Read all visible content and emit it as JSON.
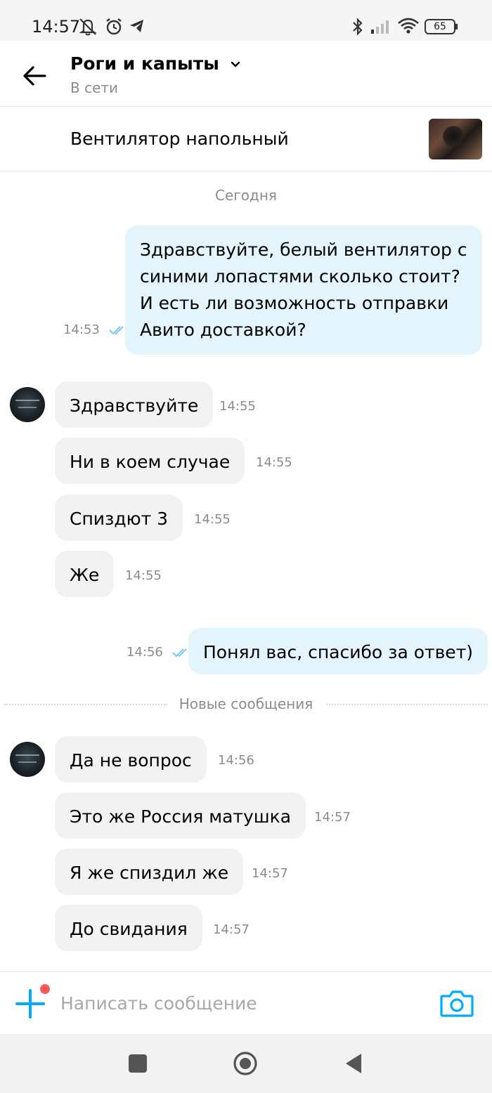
{
  "status_bar": {
    "time": "14:57",
    "battery": "65",
    "icons": [
      "notifications-off-icon",
      "alarm-icon",
      "telegram-icon",
      "bluetooth-icon",
      "signal-icon",
      "wifi-icon",
      "battery-icon"
    ]
  },
  "header": {
    "title": "Роги и капыты",
    "status": "В сети"
  },
  "item": {
    "name": "Вентилятор напольный"
  },
  "chat": {
    "date_separator": "Сегодня",
    "new_messages_label": "Новые сообщения",
    "messages": [
      {
        "dir": "out",
        "text": "Здравствуйте, белый вентилятор с синими лопастями сколько стоит? И есть ли возможность отправки Авито доставкой?",
        "time": "14:53",
        "read": true
      },
      {
        "dir": "in",
        "text": "Здравствуйте",
        "time": "14:55"
      },
      {
        "dir": "in",
        "text": "Ни в коем случае",
        "time": "14:55"
      },
      {
        "dir": "in",
        "text": "Спиздют 3",
        "time": "14:55"
      },
      {
        "dir": "in",
        "text": "Же",
        "time": "14:55"
      },
      {
        "dir": "out",
        "text": "Понял вас, спасибо за ответ)",
        "time": "14:56",
        "read": true
      },
      {
        "dir": "in",
        "text": "Да не вопрос",
        "time": "14:56"
      },
      {
        "dir": "in",
        "text": "Это же Россия матушка",
        "time": "14:57"
      },
      {
        "dir": "in",
        "text": "Я же спиздил же",
        "time": "14:57"
      },
      {
        "dir": "in",
        "text": "До свидания",
        "time": "14:57"
      }
    ]
  },
  "composer": {
    "placeholder": "Написать сообщение",
    "value": ""
  },
  "colors": {
    "accent": "#00aaff",
    "outgoing_bubble": "#e3f4fd",
    "incoming_bubble": "#f2f2f2",
    "read_check": "#7cc8f0",
    "badge": "#ff5b5b"
  }
}
